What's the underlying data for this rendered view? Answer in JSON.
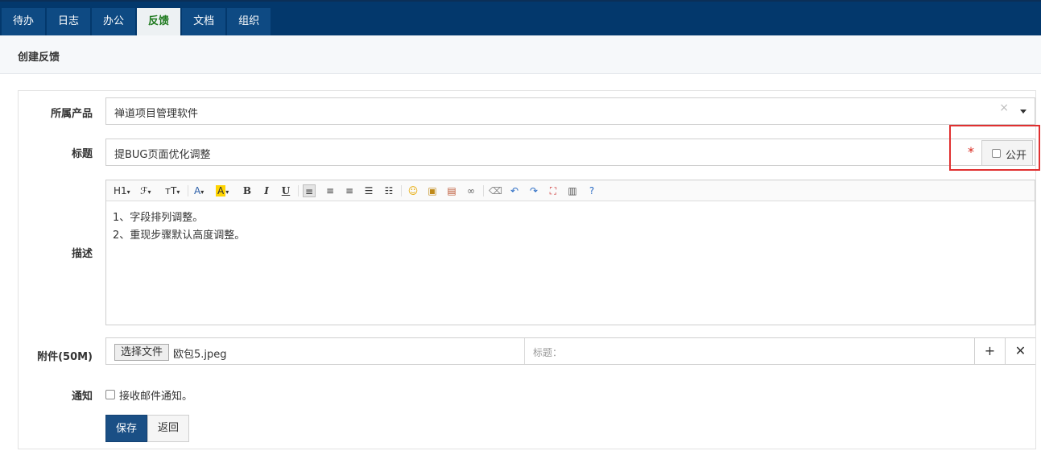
{
  "nav": {
    "tabs": [
      {
        "label": "待办"
      },
      {
        "label": "日志"
      },
      {
        "label": "办公"
      },
      {
        "label": "反馈",
        "active": true
      },
      {
        "label": "文档"
      },
      {
        "label": "组织"
      }
    ]
  },
  "page": {
    "title": "创建反馈"
  },
  "form": {
    "product": {
      "label": "所属产品",
      "value": "禅道项目管理软件"
    },
    "title": {
      "label": "标题",
      "value": "提BUG页面优化调整",
      "required_mark": "*",
      "public_label": "公开"
    },
    "description": {
      "label": "描述",
      "lines": [
        "1、字段排列调整。",
        "2、重现步骤默认高度调整。"
      ]
    },
    "attachment": {
      "label": "附件(50M)",
      "choose_button": "选择文件",
      "file_name": "欧包5.jpeg",
      "title_placeholder": "标题："
    },
    "notify": {
      "label": "通知",
      "option": "接收邮件通知。"
    },
    "buttons": {
      "save": "保存",
      "back": "返回"
    }
  },
  "toolbar": {
    "heading": "H1",
    "font": "ℱ",
    "size": "ᴛT",
    "font_color": "A",
    "bg_color": "A",
    "bold": "B",
    "italic": "I",
    "underline": "U"
  },
  "colors": {
    "nav_bg": "#03386c",
    "active_tab_text": "#1f7a1f",
    "save_button": "#1a4f85",
    "required": "#d9261c",
    "highlight": "#e03030"
  }
}
